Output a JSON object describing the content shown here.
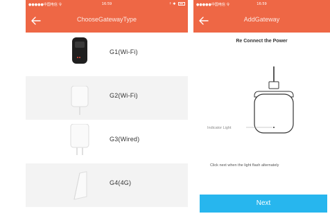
{
  "left_screen": {
    "status": {
      "carrier": "●●●●●中国电信 令",
      "time": "16:59",
      "right": "⇡ ✱"
    },
    "title": "ChooseGatewayType",
    "gateways": [
      {
        "label": "G1(Wi-Fi)"
      },
      {
        "label": "G2(Wi-Fi)"
      },
      {
        "label": "G3(Wired)"
      },
      {
        "label": "G4(4G)"
      }
    ]
  },
  "right_screen": {
    "status": {
      "carrier": "●●●●●中国电信 令",
      "time": "16:59"
    },
    "title": "AddGateway",
    "heading": "Re Connect the Power",
    "indicator_label": "Indicator Light",
    "hint": "Click next when the light flash alternately",
    "next_label": "Next"
  },
  "colors": {
    "header": "#ee6745",
    "next_button": "#27b6ee",
    "row_alt": "#f3f3f3"
  }
}
